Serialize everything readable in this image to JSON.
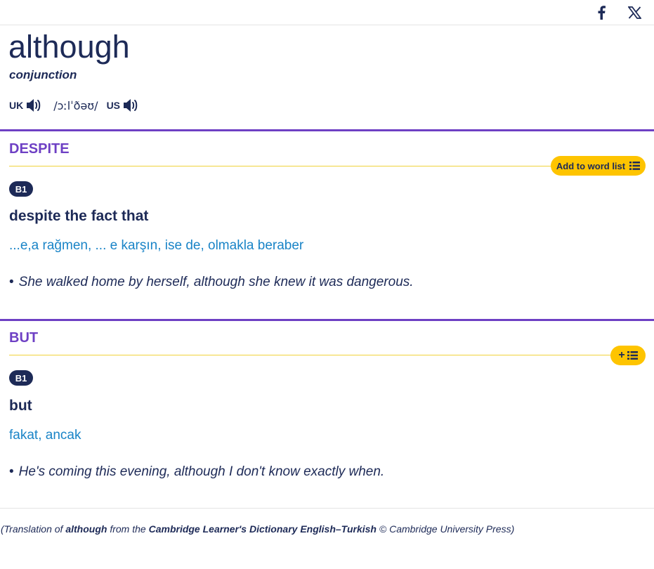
{
  "share": {
    "facebook_icon": "facebook-icon",
    "x_icon": "x-icon"
  },
  "entry": {
    "headword": "although",
    "pos": "conjunction",
    "uk_label": "UK",
    "us_label": "US",
    "ipa": "/ɔːlˈðəʊ/"
  },
  "senses": [
    {
      "guideword": "DESPITE",
      "wordlist_label": "Add to word list",
      "level": "B1",
      "definition": "despite the fact that",
      "translation": "...e,a rağmen, ... e karşın, ise de, olmakla beraber",
      "example_bullet": "•",
      "example": "She walked home by herself, although she knew it was dangerous."
    },
    {
      "guideword": "BUT",
      "wordlist_label": "+",
      "level": "B1",
      "definition": "but",
      "translation": "fakat, ancak",
      "example_bullet": "•",
      "example": "He's coming this evening, although I don't know exactly when."
    }
  ],
  "footer": {
    "prefix": "(Translation of ",
    "word": "although",
    "middle": " from the ",
    "dictionary": "Cambridge Learner's Dictionary English–Turkish",
    "suffix": " © Cambridge University Press)"
  },
  "colors": {
    "navy": "#1d2a57",
    "purple": "#6e40c4",
    "yellow": "#fec400",
    "link_blue": "#1a84c7"
  }
}
